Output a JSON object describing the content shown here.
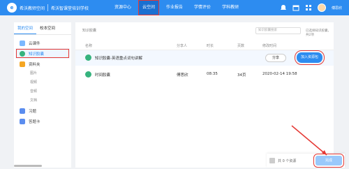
{
  "header": {
    "brand": "希沃教师空间",
    "school": "希沃智课堂培训学校",
    "nav": [
      "资源中心",
      "云空间",
      "作业报告",
      "学情评价",
      "学科教研"
    ],
    "active_nav": "云空间",
    "user": "傅思欣"
  },
  "sidebar": {
    "tabs": [
      "我的空间",
      "校本空间"
    ],
    "items": [
      {
        "label": "云课件",
        "icon": "cloud-icon"
      },
      {
        "label": "知识胶囊",
        "icon": "capsule-icon",
        "highlighted": true
      },
      {
        "label": "资料夹",
        "icon": "folder-icon"
      },
      {
        "label": "图片",
        "sub": true
      },
      {
        "label": "视频",
        "sub": true
      },
      {
        "label": "音频",
        "sub": true
      },
      {
        "label": "文档",
        "sub": true
      },
      {
        "label": "习题",
        "icon": "exercise-icon"
      },
      {
        "label": "答题卡",
        "icon": "answer-card-icon"
      }
    ]
  },
  "main": {
    "breadcrumb": "知识胶囊",
    "search_placeholder": "知识胶囊搜索",
    "note": "已选择知识胶囊，共2项",
    "columns": [
      "名称",
      "分享人",
      "时长",
      "页数",
      "修改时间"
    ],
    "rows": [
      {
        "name": "知识胶囊-英语重点词句讲解",
        "sharer": "",
        "duration": "",
        "pages": "",
        "time": "",
        "share_label": "分享",
        "add_label": "加入资源包"
      },
      {
        "name": "时间胶囊",
        "sharer": "傅思欣",
        "duration": "08:35",
        "pages": "34页",
        "time": "2020-02-14 19:58"
      }
    ]
  },
  "bottom": {
    "count_text": "共 0 个资源",
    "button": "完成"
  },
  "colors": {
    "accent": "#2d8cf0",
    "highlight": "#e53935"
  }
}
